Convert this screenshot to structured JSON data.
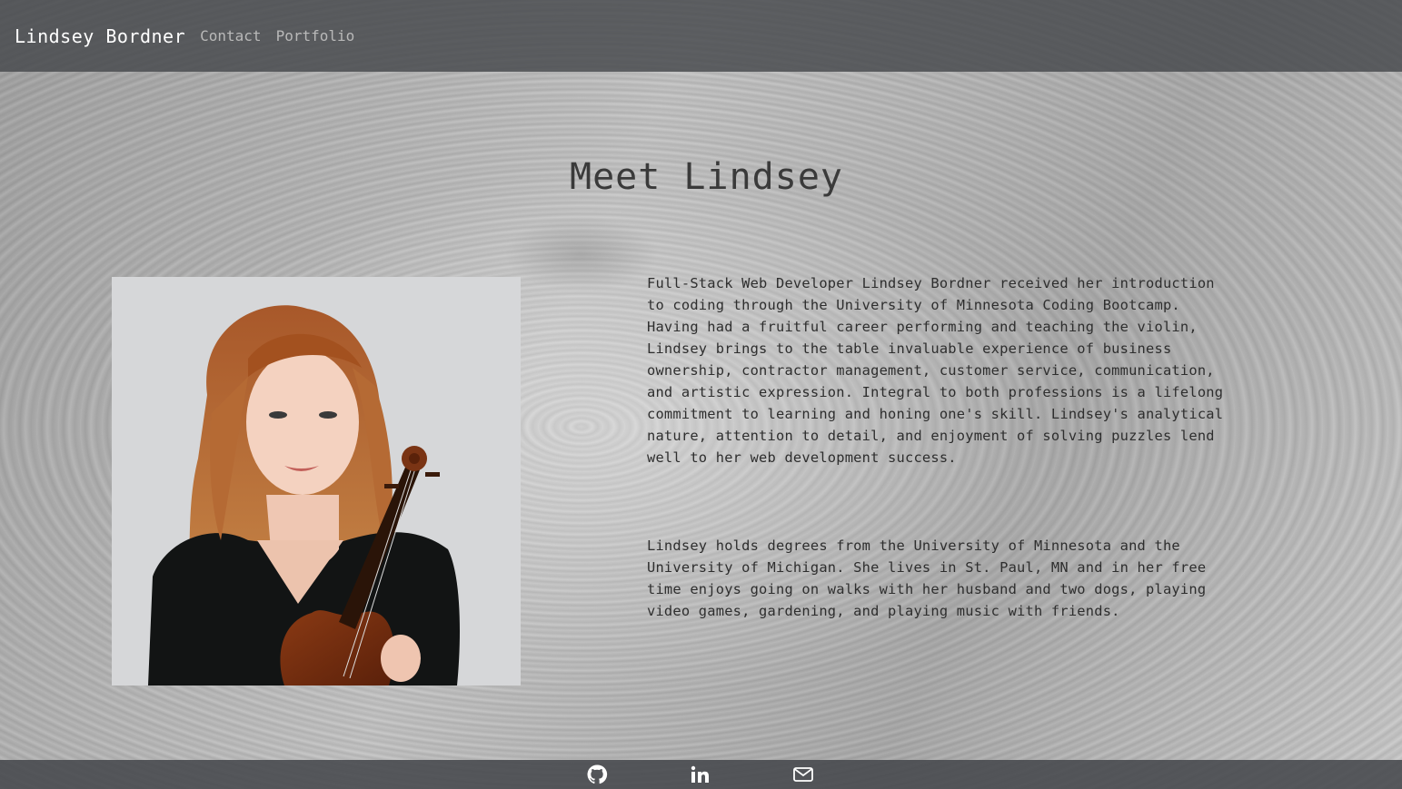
{
  "nav": {
    "brand": "Lindsey Bordner",
    "links": [
      {
        "label": "Contact"
      },
      {
        "label": "Portfolio"
      }
    ]
  },
  "main": {
    "title": "Meet Lindsey",
    "paragraphs": [
      "Full-Stack Web Developer Lindsey Bordner received her introduction\nto coding through the University of Minnesota Coding Bootcamp.\nHaving had a fruitful career performing and teaching the violin,\nLindsey brings to the table invaluable experience of business\nownership, contractor management, customer service, communication,\nand artistic expression. Integral to both professions is a lifelong\ncommitment to learning and honing one's skill. Lindsey's analytical\nnature, attention to detail, and enjoyment of solving puzzles lend\nwell to her web development success.",
      "Lindsey holds degrees from the University of Minnesota and the\nUniversity of Michigan. She lives in St. Paul, MN and in her free\ntime enjoys going on walks with her husband and two dogs, playing\nvideo games, gardening, and playing music with friends."
    ]
  },
  "footer": {
    "icons": [
      "github-icon",
      "linkedin-icon",
      "mail-icon"
    ]
  },
  "colors": {
    "bar": "#46484c",
    "brand_text": "#ffffff",
    "nav_link": "#b9b9b9",
    "body_text": "#2e2e2e"
  }
}
